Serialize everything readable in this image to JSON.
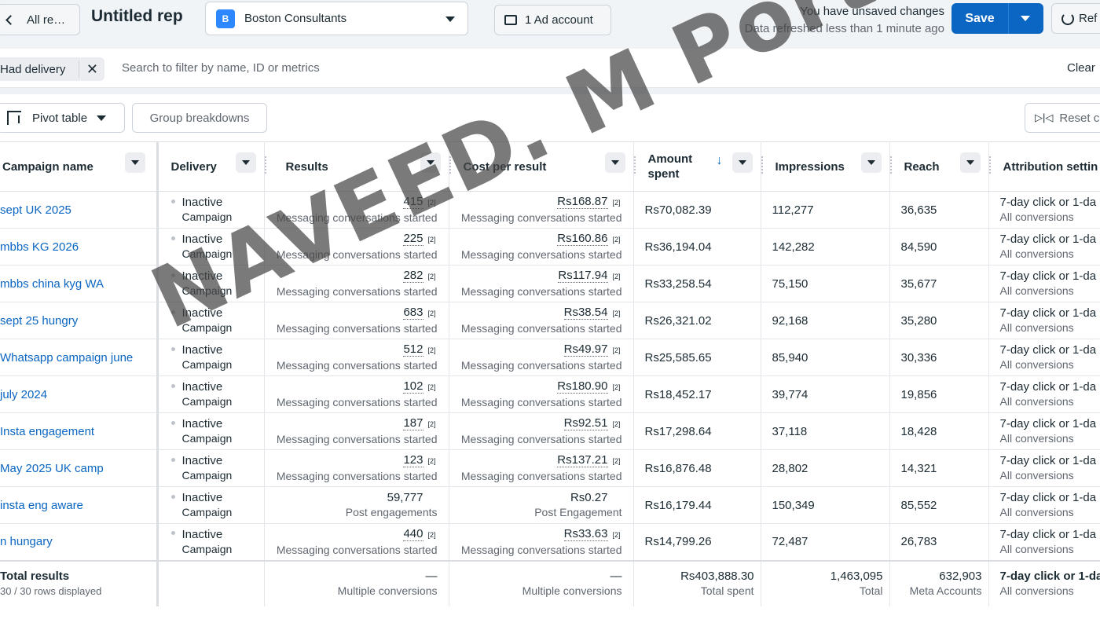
{
  "header": {
    "back_label": "All re…",
    "report_title": "Untitled rep",
    "account_badge": "B",
    "account_name": "Boston Consultants",
    "ad_account_label": "1 Ad account",
    "unsaved_text": "You have unsaved changes",
    "refreshed_text": "Data refreshed less than 1 minute ago",
    "save_label": "Save",
    "refresh_label": "Ref"
  },
  "filter": {
    "chip_label": "Had delivery",
    "search_placeholder": "Search to filter by name, ID or metrics",
    "clear_label": "Clear"
  },
  "toolbar": {
    "pivot_label": "Pivot table",
    "group_label": "Group breakdowns",
    "reset_label": "Reset co"
  },
  "columns": {
    "name": "Campaign name",
    "delivery": "Delivery",
    "results": "Results",
    "cpr": "Cost per result",
    "amount_line1": "Amount",
    "amount_line2": "spent",
    "impressions": "Impressions",
    "reach": "Reach",
    "attribution": "Attribution settin"
  },
  "rows": [
    {
      "name": "sept UK 2025",
      "delivery": "Inactive",
      "delivery_sub": "Campaign",
      "results": "415",
      "results_fn": "[2]",
      "results_sub": "Messaging conversations started",
      "cpr": "Rs168.87",
      "cpr_fn": "[2]",
      "cpr_sub": "Messaging conversations started",
      "amount": "Rs70,082.39",
      "impressions": "112,277",
      "reach": "36,635",
      "attr": "7-day click or 1-da",
      "attr_sub": "All conversions"
    },
    {
      "name": "mbbs KG 2026",
      "delivery": "Inactive",
      "delivery_sub": "Campaign",
      "results": "225",
      "results_fn": "[2]",
      "results_sub": "Messaging conversations started",
      "cpr": "Rs160.86",
      "cpr_fn": "[2]",
      "cpr_sub": "Messaging conversations started",
      "amount": "Rs36,194.04",
      "impressions": "142,282",
      "reach": "84,590",
      "attr": "7-day click or 1-da",
      "attr_sub": "All conversions"
    },
    {
      "name": "mbbs china kyg WA",
      "delivery": "Inactive",
      "delivery_sub": "Campaign",
      "results": "282",
      "results_fn": "[2]",
      "results_sub": "Messaging conversations started",
      "cpr": "Rs117.94",
      "cpr_fn": "[2]",
      "cpr_sub": "Messaging conversations started",
      "amount": "Rs33,258.54",
      "impressions": "75,150",
      "reach": "35,677",
      "attr": "7-day click or 1-da",
      "attr_sub": "All conversions"
    },
    {
      "name": "sept 25 hungry",
      "delivery": "Inactive",
      "delivery_sub": "Campaign",
      "results": "683",
      "results_fn": "[2]",
      "results_sub": "Messaging conversations started",
      "cpr": "Rs38.54",
      "cpr_fn": "[2]",
      "cpr_sub": "Messaging conversations started",
      "amount": "Rs26,321.02",
      "impressions": "92,168",
      "reach": "35,280",
      "attr": "7-day click or 1-da",
      "attr_sub": "All conversions"
    },
    {
      "name": "Whatsapp campaign june",
      "delivery": "Inactive",
      "delivery_sub": "Campaign",
      "results": "512",
      "results_fn": "[2]",
      "results_sub": "Messaging conversations started",
      "cpr": "Rs49.97",
      "cpr_fn": "[2]",
      "cpr_sub": "Messaging conversations started",
      "amount": "Rs25,585.65",
      "impressions": "85,940",
      "reach": "30,336",
      "attr": "7-day click or 1-da",
      "attr_sub": "All conversions"
    },
    {
      "name": "july 2024",
      "delivery": "Inactive",
      "delivery_sub": "Campaign",
      "results": "102",
      "results_fn": "[2]",
      "results_sub": "Messaging conversations started",
      "cpr": "Rs180.90",
      "cpr_fn": "[2]",
      "cpr_sub": "Messaging conversations started",
      "amount": "Rs18,452.17",
      "impressions": "39,774",
      "reach": "19,856",
      "attr": "7-day click or 1-da",
      "attr_sub": "All conversions"
    },
    {
      "name": "Insta engagement",
      "delivery": "Inactive",
      "delivery_sub": "Campaign",
      "results": "187",
      "results_fn": "[2]",
      "results_sub": "Messaging conversations started",
      "cpr": "Rs92.51",
      "cpr_fn": "[2]",
      "cpr_sub": "Messaging conversations started",
      "amount": "Rs17,298.64",
      "impressions": "37,118",
      "reach": "18,428",
      "attr": "7-day click or 1-da",
      "attr_sub": "All conversions"
    },
    {
      "name": "May 2025 UK camp",
      "delivery": "Inactive",
      "delivery_sub": "Campaign",
      "results": "123",
      "results_fn": "[2]",
      "results_sub": "Messaging conversations started",
      "cpr": "Rs137.21",
      "cpr_fn": "[2]",
      "cpr_sub": "Messaging conversations started",
      "amount": "Rs16,876.48",
      "impressions": "28,802",
      "reach": "14,321",
      "attr": "7-day click or 1-da",
      "attr_sub": "All conversions"
    },
    {
      "name": "insta eng aware",
      "delivery": "Inactive",
      "delivery_sub": "Campaign",
      "results": "59,777",
      "results_fn": "",
      "results_sub": "Post engagements",
      "cpr": "Rs0.27",
      "cpr_fn": "",
      "cpr_sub": "Post Engagement",
      "amount": "Rs16,179.44",
      "impressions": "150,349",
      "reach": "85,552",
      "attr": "7-day click or 1-da",
      "attr_sub": "All conversions"
    },
    {
      "name": "n hungary",
      "delivery": "Inactive",
      "delivery_sub": "Campaign",
      "results": "440",
      "results_fn": "[2]",
      "results_sub": "Messaging conversations started",
      "cpr": "Rs33.63",
      "cpr_fn": "[2]",
      "cpr_sub": "Messaging conversations started",
      "amount": "Rs14,799.26",
      "impressions": "72,487",
      "reach": "26,783",
      "attr": "7-day click or 1-da",
      "attr_sub": "All conversions"
    }
  ],
  "totals": {
    "label": "Total results",
    "rows_displayed": "30 / 30 rows displayed",
    "results": "—",
    "results_sub": "Multiple conversions",
    "cpr": "—",
    "cpr_sub": "Multiple conversions",
    "amount": "Rs403,888.30",
    "amount_sub": "Total spent",
    "impressions": "1,463,095",
    "impressions_sub": "Total",
    "reach": "632,903",
    "reach_sub": "Meta Accounts",
    "attr": "7-day click or 1-da",
    "attr_sub": "All conversions"
  },
  "watermark": "NAVEED. M Portfolio",
  "colors": {
    "accent": "#0a66c2",
    "link": "#0a66c2",
    "topbar_bg": "#f1f4f7"
  }
}
